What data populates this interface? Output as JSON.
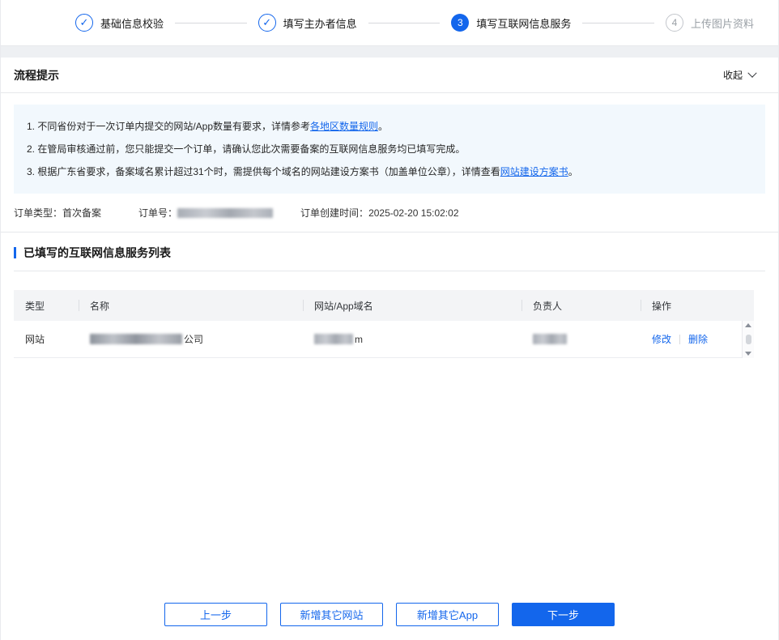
{
  "colors": {
    "accent": "#1366EC",
    "info_bg": "#F2F8FD",
    "table_header_bg": "#F3F4F6"
  },
  "icons": {
    "check": "✓"
  },
  "stepper": {
    "steps": [
      {
        "label": "基础信息校验",
        "state": "done"
      },
      {
        "label": "填写主办者信息",
        "state": "done"
      },
      {
        "label": "填写互联网信息服务",
        "state": "active",
        "number": "3"
      },
      {
        "label": "上传图片资料",
        "state": "pending",
        "number": "4"
      }
    ]
  },
  "panel": {
    "title": "流程提示",
    "collapse_label": "收起"
  },
  "tips": [
    {
      "prefix": "1. 不同省份对于一次订单内提交的网站/App数量有要求，详情参考",
      "link": "各地区数量规则",
      "suffix": "。"
    },
    {
      "prefix": "2. 在管局审核通过前，您只能提交一个订单，请确认您此次需要备案的互联网信息服务均已填写完成。",
      "link": "",
      "suffix": ""
    },
    {
      "prefix": "3. 根据广东省要求，备案域名累计超过31个时，需提供每个域名的网站建设方案书（加盖单位公章），详情查看",
      "link": "网站建设方案书",
      "suffix": "。"
    }
  ],
  "order": {
    "type_label": "订单类型：",
    "type_value": "首次备案",
    "number_label": "订单号：",
    "time_label": "订单创建时间：",
    "time_value": "2025-02-20 15:02:02"
  },
  "section_title": "已填写的互联网信息服务列表",
  "table": {
    "headers": [
      "类型",
      "名称",
      "网站/App域名",
      "负责人",
      "操作"
    ],
    "row": {
      "type": "网站",
      "name_suffix": "公司",
      "domain_suffix": "m",
      "edit_label": "修改",
      "delete_label": "删除"
    }
  },
  "footer": {
    "prev_label": "上一步",
    "add_site_label": "新增其它网站",
    "add_app_label": "新增其它App",
    "next_label": "下一步"
  }
}
